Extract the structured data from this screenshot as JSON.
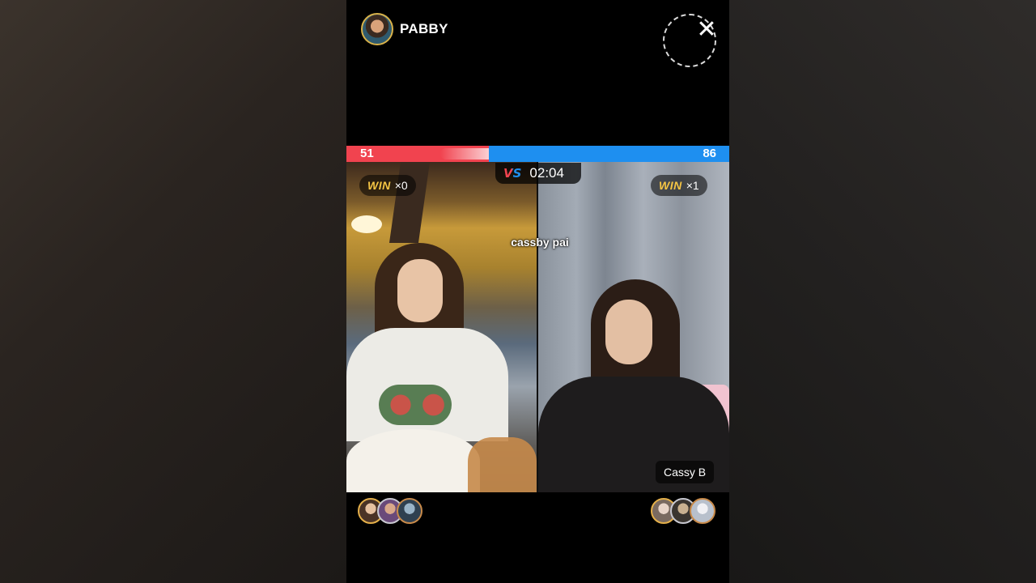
{
  "host": {
    "name": "PABBY",
    "avatar_icon": "host-avatar"
  },
  "close": {
    "icon": "close-icon",
    "glyph": "✕"
  },
  "battle": {
    "score_left": "51",
    "score_right": "86",
    "left_share": 0.372,
    "left_color": "#f1434f",
    "right_color": "#1e8ff0",
    "vs_label": "VS",
    "timer": "02:04",
    "left_win_word": "WIN",
    "left_win_count": "×0",
    "right_win_word": "WIN",
    "right_win_count": "×1",
    "overlay_text": "cassby pai",
    "right_name": "Cassy B",
    "win_color": "#f5c544"
  },
  "supporters": {
    "left": [
      "supporter-avatar",
      "supporter-avatar",
      "supporter-avatar"
    ],
    "right": [
      "supporter-avatar",
      "supporter-avatar",
      "supporter-avatar"
    ]
  }
}
